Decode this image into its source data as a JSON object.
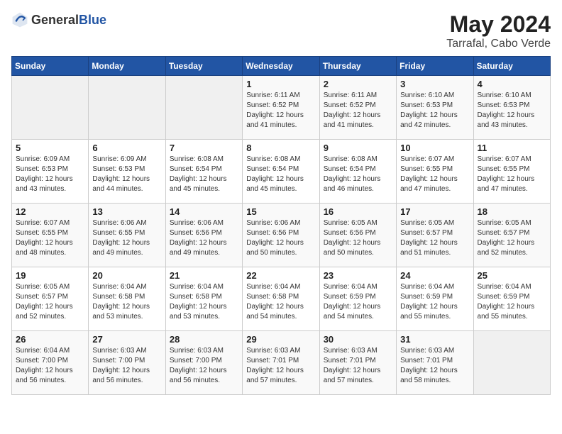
{
  "header": {
    "logo_general": "General",
    "logo_blue": "Blue",
    "title": "May 2024",
    "location": "Tarrafal, Cabo Verde"
  },
  "calendar": {
    "days_of_week": [
      "Sunday",
      "Monday",
      "Tuesday",
      "Wednesday",
      "Thursday",
      "Friday",
      "Saturday"
    ],
    "weeks": [
      [
        {
          "day": "",
          "info": ""
        },
        {
          "day": "",
          "info": ""
        },
        {
          "day": "",
          "info": ""
        },
        {
          "day": "1",
          "info": "Sunrise: 6:11 AM\nSunset: 6:52 PM\nDaylight: 12 hours\nand 41 minutes."
        },
        {
          "day": "2",
          "info": "Sunrise: 6:11 AM\nSunset: 6:52 PM\nDaylight: 12 hours\nand 41 minutes."
        },
        {
          "day": "3",
          "info": "Sunrise: 6:10 AM\nSunset: 6:53 PM\nDaylight: 12 hours\nand 42 minutes."
        },
        {
          "day": "4",
          "info": "Sunrise: 6:10 AM\nSunset: 6:53 PM\nDaylight: 12 hours\nand 43 minutes."
        }
      ],
      [
        {
          "day": "5",
          "info": "Sunrise: 6:09 AM\nSunset: 6:53 PM\nDaylight: 12 hours\nand 43 minutes."
        },
        {
          "day": "6",
          "info": "Sunrise: 6:09 AM\nSunset: 6:53 PM\nDaylight: 12 hours\nand 44 minutes."
        },
        {
          "day": "7",
          "info": "Sunrise: 6:08 AM\nSunset: 6:54 PM\nDaylight: 12 hours\nand 45 minutes."
        },
        {
          "day": "8",
          "info": "Sunrise: 6:08 AM\nSunset: 6:54 PM\nDaylight: 12 hours\nand 45 minutes."
        },
        {
          "day": "9",
          "info": "Sunrise: 6:08 AM\nSunset: 6:54 PM\nDaylight: 12 hours\nand 46 minutes."
        },
        {
          "day": "10",
          "info": "Sunrise: 6:07 AM\nSunset: 6:55 PM\nDaylight: 12 hours\nand 47 minutes."
        },
        {
          "day": "11",
          "info": "Sunrise: 6:07 AM\nSunset: 6:55 PM\nDaylight: 12 hours\nand 47 minutes."
        }
      ],
      [
        {
          "day": "12",
          "info": "Sunrise: 6:07 AM\nSunset: 6:55 PM\nDaylight: 12 hours\nand 48 minutes."
        },
        {
          "day": "13",
          "info": "Sunrise: 6:06 AM\nSunset: 6:55 PM\nDaylight: 12 hours\nand 49 minutes."
        },
        {
          "day": "14",
          "info": "Sunrise: 6:06 AM\nSunset: 6:56 PM\nDaylight: 12 hours\nand 49 minutes."
        },
        {
          "day": "15",
          "info": "Sunrise: 6:06 AM\nSunset: 6:56 PM\nDaylight: 12 hours\nand 50 minutes."
        },
        {
          "day": "16",
          "info": "Sunrise: 6:05 AM\nSunset: 6:56 PM\nDaylight: 12 hours\nand 50 minutes."
        },
        {
          "day": "17",
          "info": "Sunrise: 6:05 AM\nSunset: 6:57 PM\nDaylight: 12 hours\nand 51 minutes."
        },
        {
          "day": "18",
          "info": "Sunrise: 6:05 AM\nSunset: 6:57 PM\nDaylight: 12 hours\nand 52 minutes."
        }
      ],
      [
        {
          "day": "19",
          "info": "Sunrise: 6:05 AM\nSunset: 6:57 PM\nDaylight: 12 hours\nand 52 minutes."
        },
        {
          "day": "20",
          "info": "Sunrise: 6:04 AM\nSunset: 6:58 PM\nDaylight: 12 hours\nand 53 minutes."
        },
        {
          "day": "21",
          "info": "Sunrise: 6:04 AM\nSunset: 6:58 PM\nDaylight: 12 hours\nand 53 minutes."
        },
        {
          "day": "22",
          "info": "Sunrise: 6:04 AM\nSunset: 6:58 PM\nDaylight: 12 hours\nand 54 minutes."
        },
        {
          "day": "23",
          "info": "Sunrise: 6:04 AM\nSunset: 6:59 PM\nDaylight: 12 hours\nand 54 minutes."
        },
        {
          "day": "24",
          "info": "Sunrise: 6:04 AM\nSunset: 6:59 PM\nDaylight: 12 hours\nand 55 minutes."
        },
        {
          "day": "25",
          "info": "Sunrise: 6:04 AM\nSunset: 6:59 PM\nDaylight: 12 hours\nand 55 minutes."
        }
      ],
      [
        {
          "day": "26",
          "info": "Sunrise: 6:04 AM\nSunset: 7:00 PM\nDaylight: 12 hours\nand 56 minutes."
        },
        {
          "day": "27",
          "info": "Sunrise: 6:03 AM\nSunset: 7:00 PM\nDaylight: 12 hours\nand 56 minutes."
        },
        {
          "day": "28",
          "info": "Sunrise: 6:03 AM\nSunset: 7:00 PM\nDaylight: 12 hours\nand 56 minutes."
        },
        {
          "day": "29",
          "info": "Sunrise: 6:03 AM\nSunset: 7:01 PM\nDaylight: 12 hours\nand 57 minutes."
        },
        {
          "day": "30",
          "info": "Sunrise: 6:03 AM\nSunset: 7:01 PM\nDaylight: 12 hours\nand 57 minutes."
        },
        {
          "day": "31",
          "info": "Sunrise: 6:03 AM\nSunset: 7:01 PM\nDaylight: 12 hours\nand 58 minutes."
        },
        {
          "day": "",
          "info": ""
        }
      ]
    ]
  }
}
